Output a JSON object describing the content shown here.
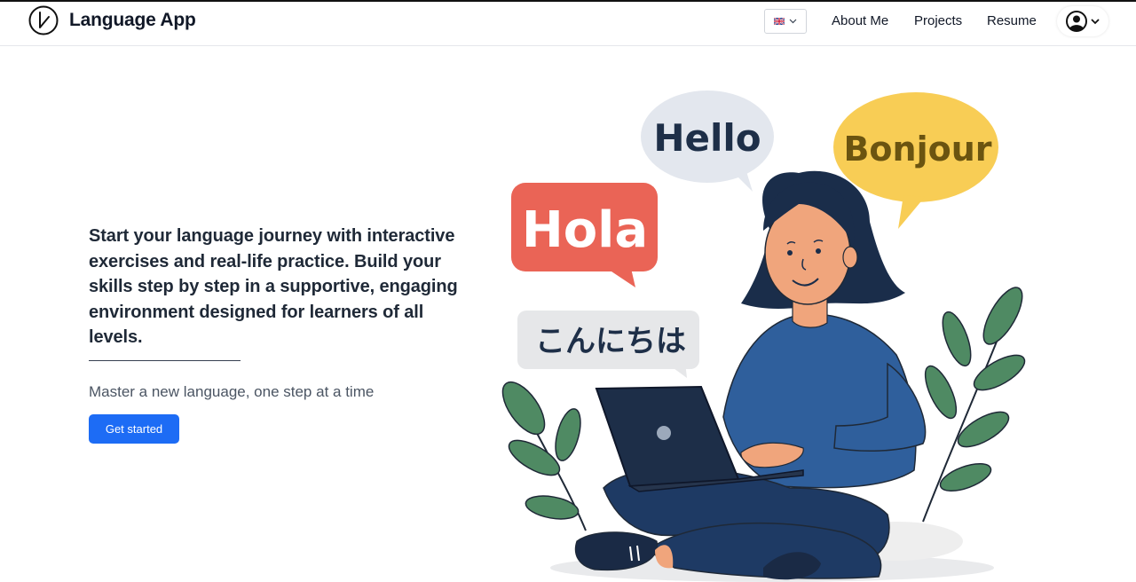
{
  "header": {
    "app_name": "Language App",
    "language_selector": {
      "flag_icon": "uk-flag-icon",
      "chevron_icon": "chevron-down-icon"
    },
    "nav": [
      {
        "label": "About Me"
      },
      {
        "label": "Projects"
      },
      {
        "label": "Resume"
      }
    ],
    "user_menu": {
      "avatar_icon": "user-circle-icon",
      "chevron_icon": "chevron-down-icon"
    }
  },
  "hero": {
    "heading": "Start your language journey with interactive exercises and real-life practice. Build your skills step by step in a supportive, engaging environment designed for learners of all levels.",
    "tagline": "Master a new language, one step at a time",
    "cta_label": "Get started"
  },
  "illustration": {
    "bubbles": {
      "hello": "Hello",
      "bonjour": "Bonjour",
      "hola": "Hola",
      "konnichiwa": "こんにちは"
    }
  },
  "colors": {
    "accent": "#1d6cf5",
    "hello_bubble": "#e3e7ee",
    "bonjour_bubble": "#f8cd55",
    "hola_bubble": "#ea6456",
    "konnichiwa_bubble": "#e6e7e9",
    "shirt": "#2f5f9c",
    "leaves": "#4f8a63"
  }
}
